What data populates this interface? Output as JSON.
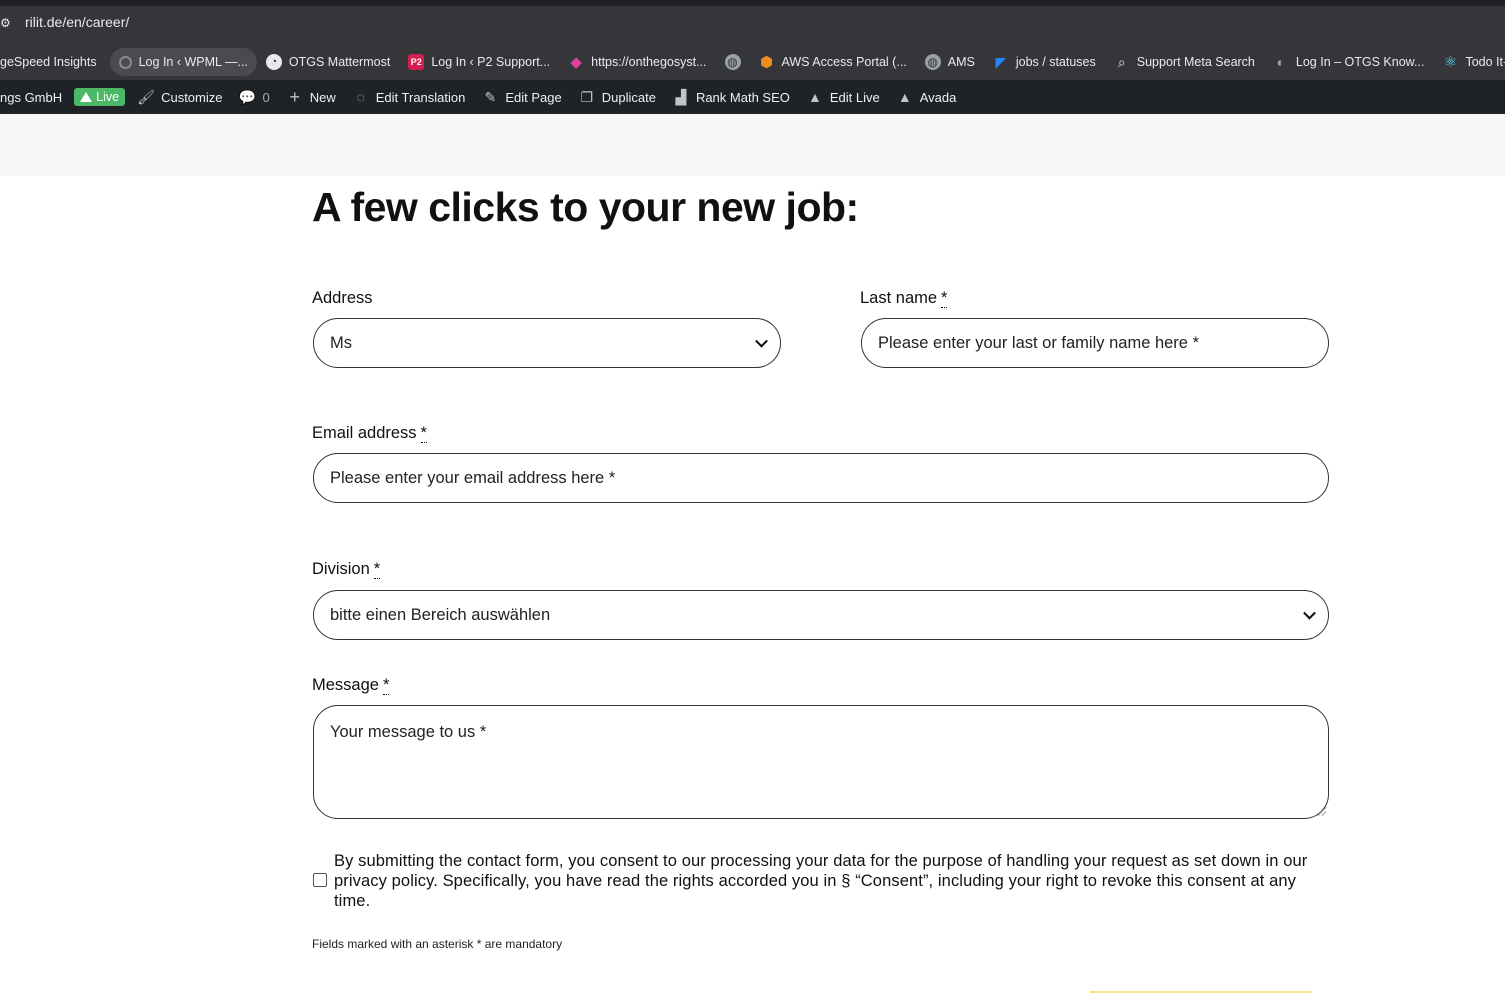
{
  "browser": {
    "url": "rilit.de/en/career/",
    "bookmarks": [
      {
        "label": "geSpeed Insights",
        "icon": "none"
      },
      {
        "label": "Log In ‹ WPML —...",
        "icon": "loading-icon",
        "active": true
      },
      {
        "label": "OTGS Mattermost",
        "icon": "mattermost-icon"
      },
      {
        "label": "Log In ‹ P2 Support...",
        "icon": "p2-icon"
      },
      {
        "label": "https://onthegosyst...",
        "icon": "pink-logo-icon"
      },
      {
        "label": "",
        "icon": "globe-icon"
      },
      {
        "label": "AWS Access Portal (...",
        "icon": "aws-cube-icon"
      },
      {
        "label": "AMS",
        "icon": "globe-icon"
      },
      {
        "label": "jobs / statuses",
        "icon": "jira-icon"
      },
      {
        "label": "Support Meta Search",
        "icon": "search-icon"
      },
      {
        "label": "Log In – OTGS Know...",
        "icon": "otgs-icon"
      },
      {
        "label": "Todo It- React",
        "icon": "react-icon"
      },
      {
        "label": "",
        "icon": "cb-icon"
      }
    ]
  },
  "adminbar": {
    "site_name": "ngs GmbH",
    "live": "Live",
    "customize": "Customize",
    "comments": "0",
    "new": "New",
    "edit_translation": "Edit Translation",
    "edit_page": "Edit Page",
    "duplicate": "Duplicate",
    "rank_math": "Rank Math SEO",
    "edit_live": "Edit Live",
    "avada": "Avada"
  },
  "form": {
    "title": "A few clicks to your new job:",
    "address_label": "Address",
    "address_value": "Ms",
    "lastname_label": "Last name",
    "lastname_placeholder": "Please enter your last or family name here *",
    "email_label": "Email address",
    "email_placeholder": "Please enter your email address here *",
    "division_label": "Division",
    "division_value": "bitte einen Bereich auswählen",
    "message_label": "Message",
    "message_placeholder": "Your message to us *",
    "required_mark": "*",
    "consent": "By submitting the contact form, you consent to our processing your data for the purpose of handling your request as set down in our privacy policy. Specifically, you have read the rights accorded you in § “Consent”, including your right to revoke this consent at any time.",
    "mandatory_note": "Fields marked with an asterisk * are mandatory"
  },
  "colors": {
    "chrome_bg": "#35363a",
    "adminbar_bg": "#1d2327",
    "live_green": "#4ab866",
    "submit_yellow": "#f4e48a"
  }
}
